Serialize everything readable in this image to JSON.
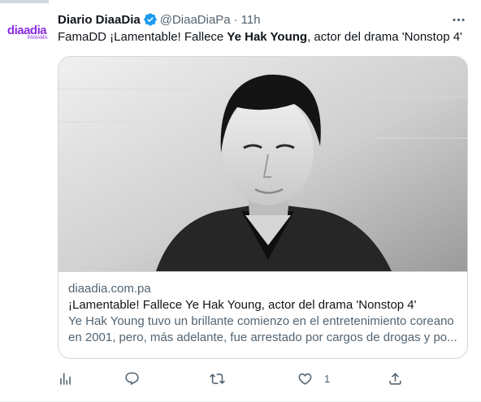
{
  "account": {
    "avatar_text": "diaadia",
    "avatar_subtext": "PANAMA",
    "name": "Diario DiaaDia",
    "handle": "@DiaaDiaPa",
    "separator": "·",
    "time": "11h"
  },
  "tweet": {
    "text_before": "FamaDD ¡Lamentable! Fallece ",
    "text_bold": "Ye Hak Young",
    "text_after": ", actor del drama 'Nonstop 4'"
  },
  "card": {
    "image_icon": "portrait-photo",
    "domain": "diaadia.com.pa",
    "title": "¡Lamentable! Fallece Ye Hak Young, actor del drama 'Nonstop 4'",
    "description": "Ye Hak Young tuvo un brillante comienzo en el entretenimiento coreano en 2001, pero, más adelante, fue arrestado por cargos de drogas y po..."
  },
  "actions": {
    "analytics_icon": "bar-chart-icon",
    "reply_icon": "reply-icon",
    "retweet_icon": "retweet-icon",
    "like_icon": "heart-icon",
    "like_count": "1",
    "share_icon": "share-icon"
  },
  "colors": {
    "verified": "#1d9bf0",
    "secondary_text": "#536471",
    "border": "#cfd9de"
  }
}
